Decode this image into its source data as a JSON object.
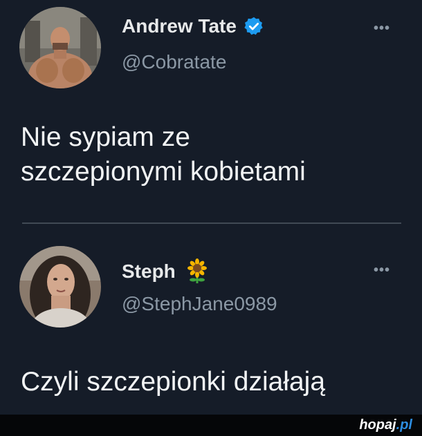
{
  "tweets": [
    {
      "display_name": "Andrew Tate",
      "handle": "@Cobratate",
      "verified": true,
      "more_label": "•••",
      "text_lines": [
        "Nie sypiam ze",
        "szczepionymi kobietami"
      ]
    },
    {
      "display_name": "Steph",
      "handle": "@StephJane0989",
      "emoji": "🌻",
      "more_label": "•••",
      "text_lines": [
        "Czyli szczepionki działają"
      ]
    }
  ],
  "footer": {
    "brand_main": "hopaj",
    "brand_accent": ".pl"
  },
  "colors": {
    "background": "#151c28",
    "verified_badge": "#1d9bf0",
    "handle": "#8b98a5",
    "brand_accent": "#2d8de0"
  },
  "icons": {
    "verified": "verified-badge-icon",
    "more": "more-options-icon",
    "sunflower": "sunflower-emoji-icon"
  }
}
